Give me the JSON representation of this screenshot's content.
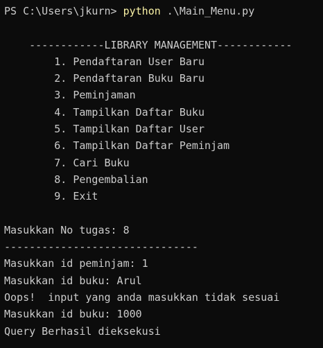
{
  "terminal": {
    "prompt": {
      "path": "PS C:\\Users\\jkurn> ",
      "command": "python",
      "args": " .\\Main_Menu.py"
    },
    "menu": {
      "title": "    ------------LIBRARY MANAGEMENT------------",
      "items": [
        "        1. Pendaftaran User Baru",
        "        2. Pendaftaran Buku Baru",
        "        3. Peminjaman",
        "        4. Tampilkan Daftar Buku",
        "        5. Tampilkan Daftar User",
        "        6. Tampilkan Daftar Peminjam",
        "        7. Cari Buku",
        "        8. Pengembalian",
        "        9. Exit"
      ]
    },
    "output": [
      "Masukkan No tugas: 8",
      "-------------------------------",
      "Masukkan id peminjam: 1",
      "Masukkan id buku: Arul",
      "Oops!  input yang anda masukkan tidak sesuai",
      "Masukkan id buku: 1000",
      "Query Berhasil dieksekusi"
    ]
  }
}
